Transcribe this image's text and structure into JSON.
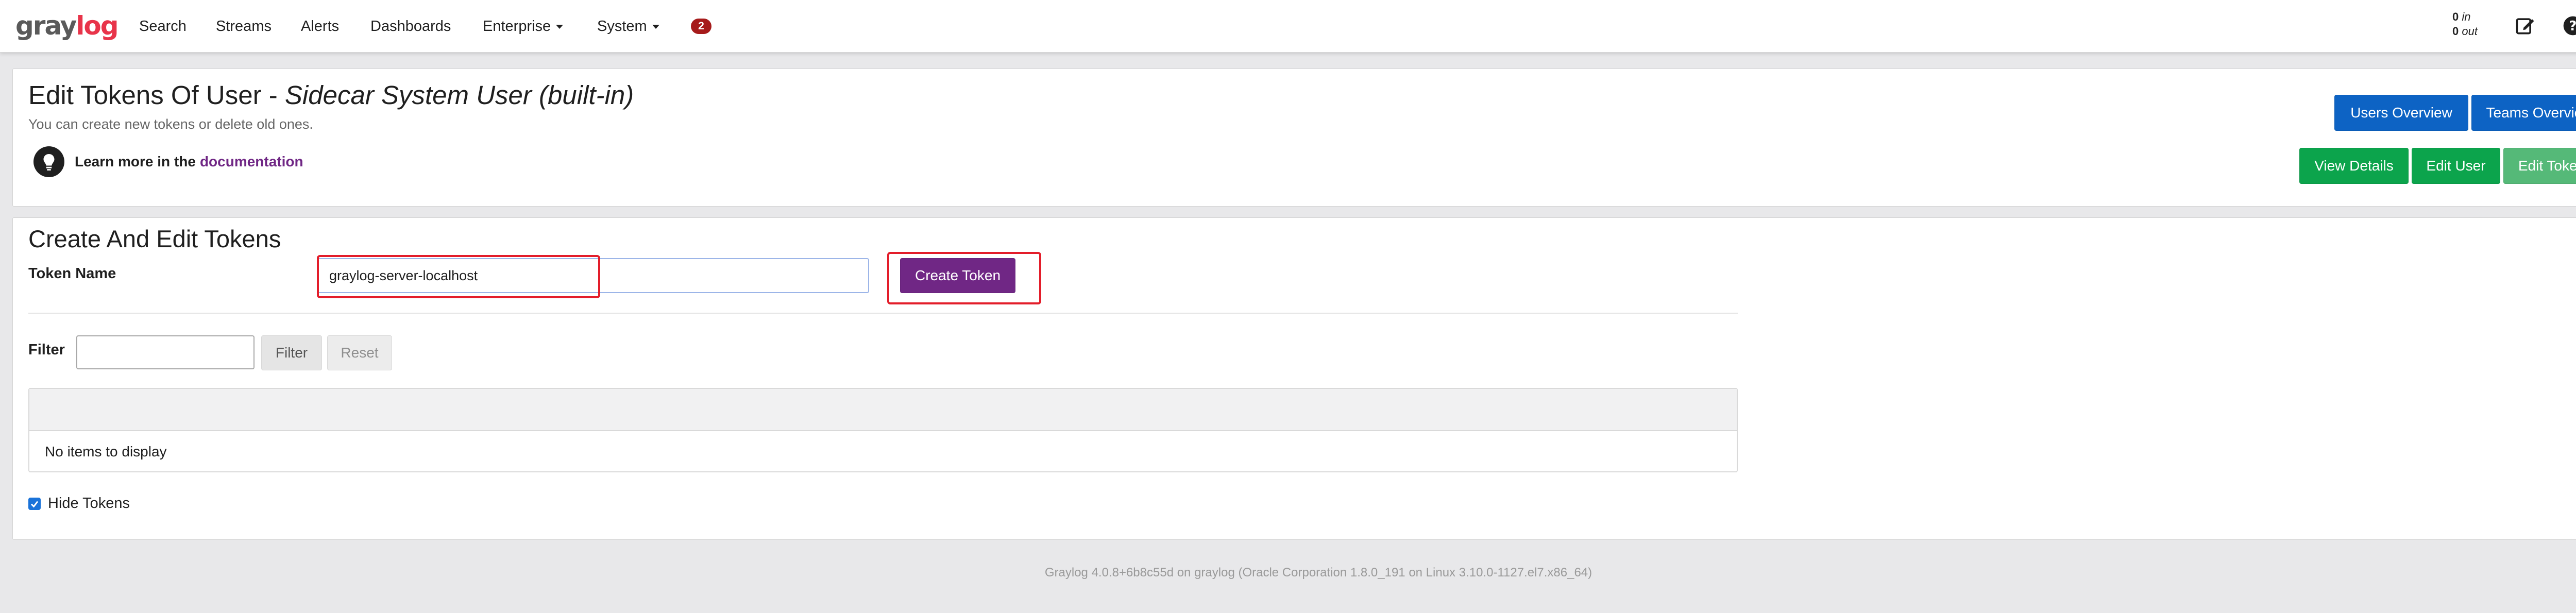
{
  "nav": {
    "logo_gray": "gray",
    "logo_red": "log",
    "items": [
      {
        "label": "Search"
      },
      {
        "label": "Streams"
      },
      {
        "label": "Alerts"
      },
      {
        "label": "Dashboards"
      },
      {
        "label": "Enterprise"
      },
      {
        "label": "System"
      }
    ],
    "notification_count": "2",
    "throughput": {
      "in_value": "0",
      "in_label": "in",
      "out_value": "0",
      "out_label": "out"
    },
    "icons": [
      "edit-icon",
      "help-icon",
      "user-icon"
    ]
  },
  "header": {
    "title_prefix": "Edit Tokens Of User - ",
    "title_user": "Sidecar System User (built-in)",
    "subtitle": "You can create new tokens or delete old ones.",
    "learn_more": "Learn more in the",
    "learn_link": "documentation",
    "buttons": {
      "users_overview": "Users Overview",
      "teams_overview": "Teams Overview",
      "view_details": "View Details",
      "edit_user": "Edit User",
      "edit_tokens": "Edit Tokens"
    }
  },
  "tokens": {
    "section_title": "Create And Edit Tokens",
    "token_name_label": "Token Name",
    "token_name_value": "graylog-server-localhost",
    "create_button": "Create Token",
    "filter_label": "Filter",
    "filter_value": "",
    "filter_button": "Filter",
    "reset_button": "Reset",
    "empty_message": "No items to display",
    "hide_tokens_label": "Hide Tokens",
    "hide_tokens_checked": true
  },
  "footer": {
    "text": "Graylog 4.0.8+6b8c55d on graylog (Oracle Corporation 1.8.0_191 on Linux 3.10.0-1127.el7.x86_64)"
  },
  "colors": {
    "accent_purple": "#702785",
    "primary_blue": "#0d63c4",
    "success_green": "#0ca44c",
    "highlight_red": "#e31d2a",
    "badge_red": "#a61b1b"
  }
}
